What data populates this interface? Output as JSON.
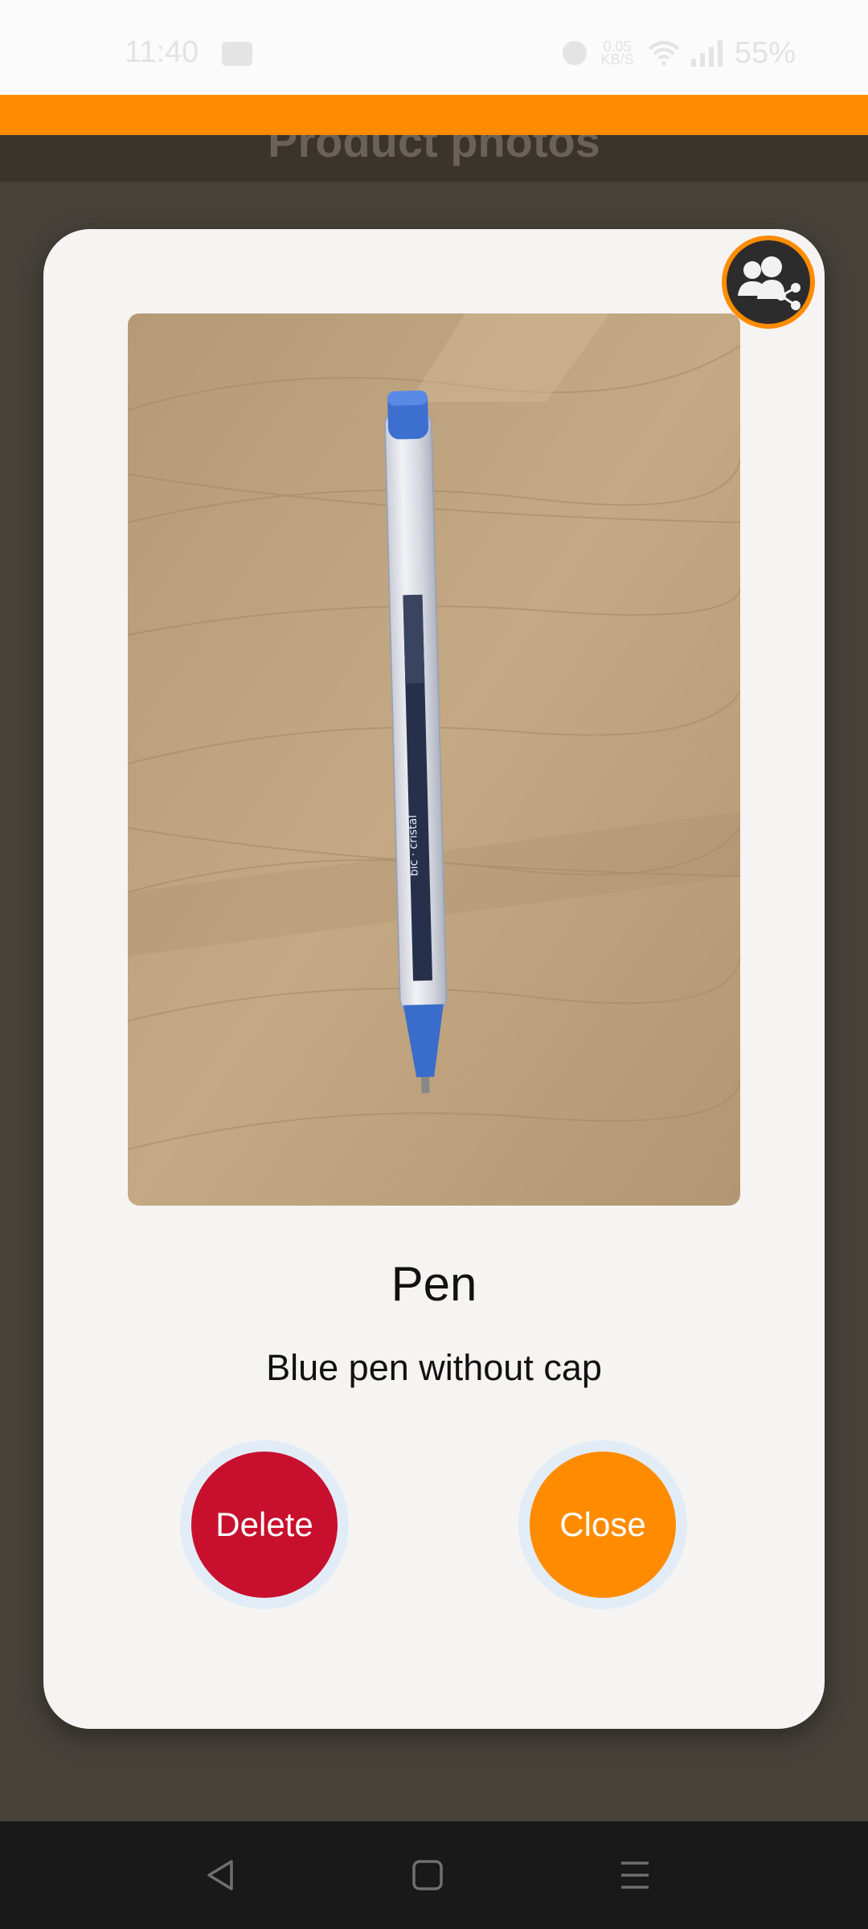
{
  "status_bar": {
    "time": "11:40",
    "speed_value": "0.05",
    "speed_unit": "KB/S",
    "battery": "55%"
  },
  "app_bar": {
    "title": "Product photos"
  },
  "dialog": {
    "share_icon": "share-users-icon",
    "photo_alt": "Blue pen without cap on wooden table",
    "item_name": "Pen",
    "item_description": "Blue pen without cap",
    "delete_label": "Delete",
    "close_label": "Close"
  },
  "nav_bar": {
    "back_icon": "back-triangle-icon",
    "home_icon": "home-square-icon",
    "recents_icon": "recents-menu-icon"
  },
  "colors": {
    "accent": "#ff8c00",
    "delete": "#c8102e",
    "dialog_bg": "#f5f4f2",
    "scrim": "#4a4540"
  }
}
